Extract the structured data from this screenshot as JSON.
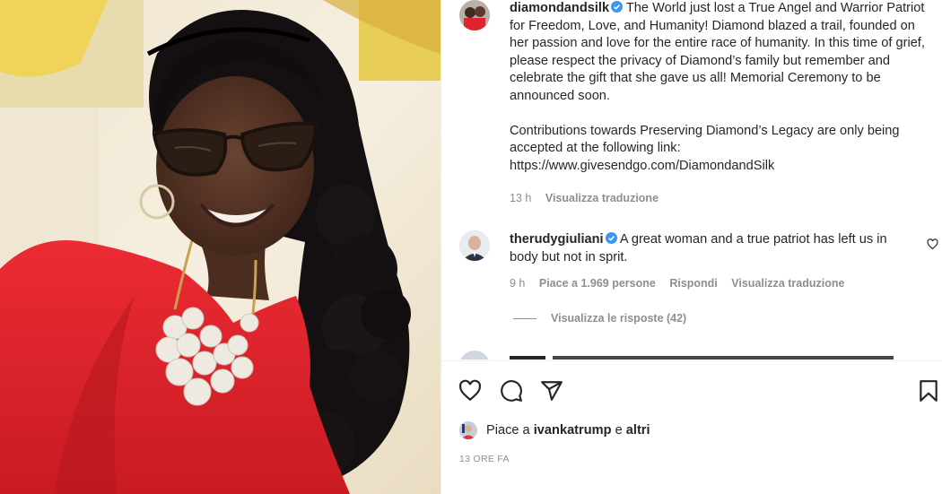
{
  "caption": {
    "username": "diamondandsilk",
    "paragraph1": "The World just lost a True Angel and Warrior Patriot for Freedom, Love, and Humanity! Diamond blazed a trail, founded on her passion and love for the entire race of humanity. In this time of grief, please respect the privacy of Diamond’s family but remember and celebrate the gift that she gave us all! Memorial Ceremony to be announced soon.",
    "paragraph2": "Contributions towards Preserving Diamond’s Legacy are only being accepted at the following link: https://www.givesendgo.com/DiamondandSilk",
    "time": "13 h",
    "translate": "Visualizza traduzione"
  },
  "comment": {
    "username": "therudygiuliani",
    "text": "A great woman and a true patriot has left us in body but not in sprit.",
    "time": "9 h",
    "likes": "Piace a 1.969 persone",
    "reply": "Rispondi",
    "translate": "Visualizza traduzione",
    "view_replies": "Visualizza le risposte (42)"
  },
  "likes_row": {
    "prefix": "Piace a",
    "user": "ivankatrump",
    "mid": "e",
    "others": "altri"
  },
  "time_ago": "13 ORE FA",
  "icons": {
    "like": "heart-icon",
    "comment": "comment-icon",
    "share": "share-icon",
    "save": "bookmark-icon",
    "verified": "verified-badge-icon"
  },
  "colors": {
    "verified": "#3897f0",
    "text": "#262626",
    "muted": "#8e8e8e",
    "dress": "#e0232c"
  }
}
